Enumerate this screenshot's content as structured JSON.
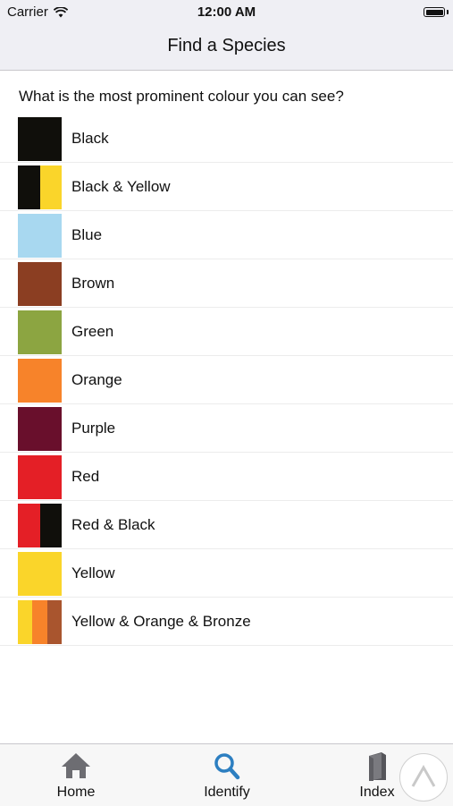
{
  "status": {
    "carrier": "Carrier",
    "time": "12:00 AM"
  },
  "nav": {
    "title": "Find a Species"
  },
  "question": "What is the most prominent colour you can see?",
  "colors": [
    {
      "label": "Black",
      "swatch": [
        "#100f0b"
      ]
    },
    {
      "label": "Black & Yellow",
      "swatch": [
        "#100f0b",
        "#fad52a"
      ]
    },
    {
      "label": "Blue",
      "swatch": [
        "#a8d8f0"
      ]
    },
    {
      "label": "Brown",
      "swatch": [
        "#8b3e22"
      ]
    },
    {
      "label": "Green",
      "swatch": [
        "#8ca541"
      ]
    },
    {
      "label": "Orange",
      "swatch": [
        "#f7832a"
      ]
    },
    {
      "label": "Purple",
      "swatch": [
        "#690f2c"
      ]
    },
    {
      "label": "Red",
      "swatch": [
        "#e41f26"
      ]
    },
    {
      "label": "Red & Black",
      "swatch": [
        "#e41f26",
        "#100f0b"
      ]
    },
    {
      "label": "Yellow",
      "swatch": [
        "#fad52a"
      ]
    },
    {
      "label": "Yellow & Orange & Bronze",
      "swatch": [
        "#fad52a",
        "#f7832a",
        "#a9552e"
      ]
    }
  ],
  "tabs": [
    {
      "label": "Home",
      "icon": "home-icon",
      "active": false
    },
    {
      "label": "Identify",
      "icon": "search-icon",
      "active": true
    },
    {
      "label": "Index",
      "icon": "book-icon",
      "active": false
    }
  ],
  "accent_color": "#2d7fc1",
  "icon_color": "#6d6d72"
}
